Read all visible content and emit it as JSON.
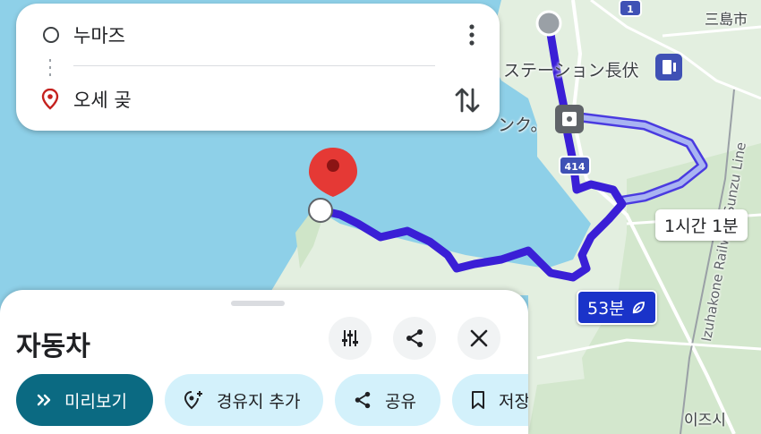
{
  "search": {
    "origin": "누마즈",
    "destination": "오세 곶"
  },
  "map": {
    "labels": {
      "station": "ステーション長伏",
      "kanji_partial": "ンク。",
      "city_top": "三島市",
      "railway": "Izuhakone Railway Sunzu Line",
      "izushi": "이즈시",
      "route_414": "414",
      "route_1": "1"
    },
    "routes": {
      "main_time": "53분",
      "alt_time": "1시간 1분"
    },
    "colors": {
      "sea": "#8ed0e8",
      "land": "#e3efe0",
      "main_route": "#3a1fd6",
      "alt_route": "#a9b4f2"
    }
  },
  "sheet": {
    "title": "자동차",
    "chips": {
      "preview": "미리보기",
      "add_waypoint": "경유지 추가",
      "share": "공유",
      "save": "저장"
    }
  }
}
